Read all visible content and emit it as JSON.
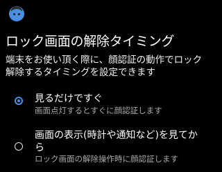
{
  "header": {
    "icon": "face-icon"
  },
  "page": {
    "title": "ロック画面の解除タイミング",
    "description": "端末をお使い頂く際に、顔認証の動作でロック解除するタイミングを設定できます"
  },
  "options": [
    {
      "title": "見るだけですぐ",
      "subtitle": "画面点灯するとすぐに顔認証します",
      "selected": true
    },
    {
      "title": "画面の表示(時計や通知など)を見てから",
      "subtitle": "ロック画面の解除操作時に顔認証します",
      "selected": false
    }
  ],
  "colors": {
    "background": "#000000",
    "accent": "#4a90e2",
    "subtitle": "#a8a8a8"
  }
}
